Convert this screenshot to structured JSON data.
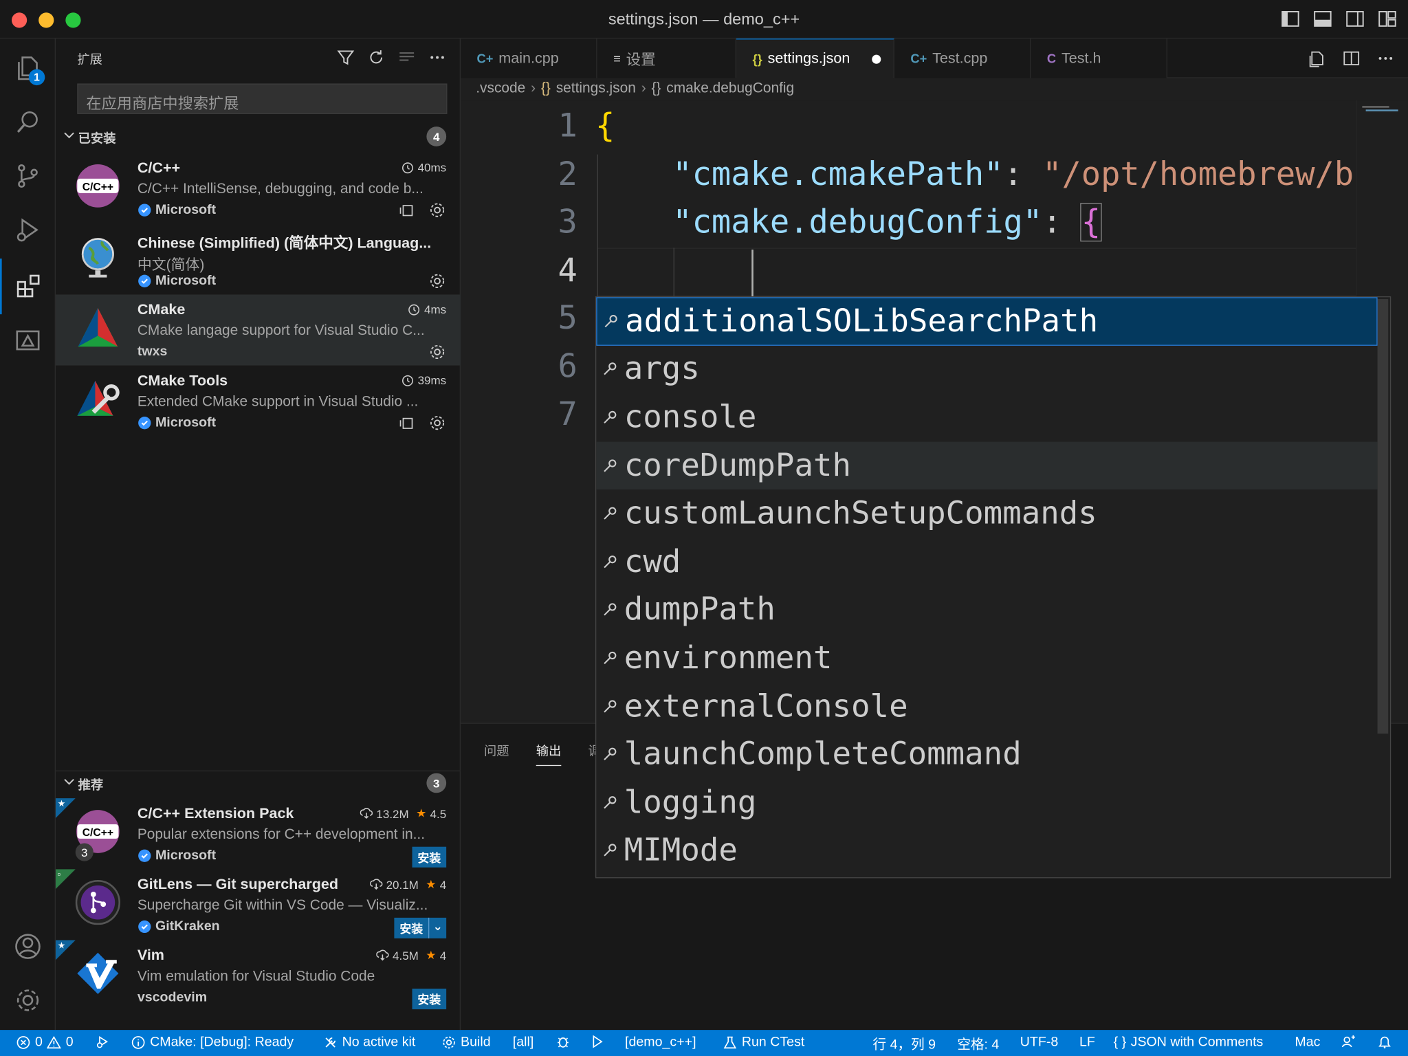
{
  "window": {
    "title": "settings.json — demo_c++"
  },
  "activity": {
    "explorer_badge": "1"
  },
  "sidebar": {
    "header": "扩展",
    "search_placeholder": "在应用商店中搜索扩展",
    "installed": {
      "label": "已安装",
      "count": "4",
      "items": [
        {
          "name": "C/C++",
          "desc": "C/C++ IntelliSense, debugging, and code b...",
          "publisher": "Microsoft",
          "time": "40ms",
          "logo_text": "C/C++"
        },
        {
          "name": "Chinese (Simplified) (简体中文) Languag...",
          "desc": "中文(简体)",
          "publisher": "Microsoft",
          "time": ""
        },
        {
          "name": "CMake",
          "desc": "CMake langage support for Visual Studio C...",
          "publisher": "twxs",
          "time": "4ms"
        },
        {
          "name": "CMake Tools",
          "desc": "Extended CMake support in Visual Studio ...",
          "publisher": "Microsoft",
          "time": "39ms"
        }
      ]
    },
    "recommended": {
      "label": "推荐",
      "count": "3",
      "items": [
        {
          "name": "C/C++ Extension Pack",
          "desc": "Popular extensions for C++ development in...",
          "publisher": "Microsoft",
          "downloads": "13.2M",
          "rating": "4.5",
          "install": "安装",
          "logo_text": "C/C++",
          "pack_count": "3"
        },
        {
          "name": "GitLens — Git supercharged",
          "desc": "Supercharge Git within VS Code — Visualiz...",
          "publisher": "GitKraken",
          "downloads": "20.1M",
          "rating": "4",
          "install": "安装"
        },
        {
          "name": "Vim",
          "desc": "Vim emulation for Visual Studio Code",
          "publisher": "vscodevim",
          "downloads": "4.5M",
          "rating": "4",
          "install": "安装"
        }
      ]
    }
  },
  "tabs": [
    {
      "label": "main.cpp",
      "icon": "C+"
    },
    {
      "label": "设置",
      "icon": "≡"
    },
    {
      "label": "settings.json",
      "icon": "{}"
    },
    {
      "label": "Test.cpp",
      "icon": "C+"
    },
    {
      "label": "Test.h",
      "icon": "C"
    }
  ],
  "breadcrumb": [
    ".vscode",
    "settings.json",
    "cmake.debugConfig"
  ],
  "editor": {
    "line_numbers": [
      "1",
      "2",
      "3",
      "4",
      "5",
      "6",
      "7"
    ],
    "lines": {
      "l1_brace": "{",
      "l2_key": "\"cmake.cmakePath\"",
      "l2_colon": ": ",
      "l2_val": "\"/opt/homebrew/bi",
      "l3_key": "\"cmake.debugConfig\"",
      "l3_colon": ": ",
      "l3_brace": "{"
    }
  },
  "suggestions": [
    "additionalSOLibSearchPath",
    "args",
    "console",
    "coreDumpPath",
    "customLaunchSetupCommands",
    "cwd",
    "dumpPath",
    "environment",
    "externalConsole",
    "launchCompleteCommand",
    "logging",
    "MIMode"
  ],
  "panel": {
    "tabs": [
      "问题",
      "输出",
      "调"
    ]
  },
  "statusbar": {
    "errors": "0",
    "warnings": "0",
    "cmake_status": "CMake: [Debug]: Ready",
    "kit": "No active kit",
    "build": "Build",
    "build_target": "[all]",
    "launch_target": "[demo_c++]",
    "ctest": "Run CTest",
    "position": "行 4，列 9",
    "spaces": "空格: 4",
    "encoding": "UTF-8",
    "eol": "LF",
    "language": "JSON with Comments",
    "platform": "Mac"
  },
  "colors": {
    "accent": "#0078d4",
    "statusbar": "#0078d4",
    "selection": "#04395e",
    "install": "#0e639c"
  }
}
